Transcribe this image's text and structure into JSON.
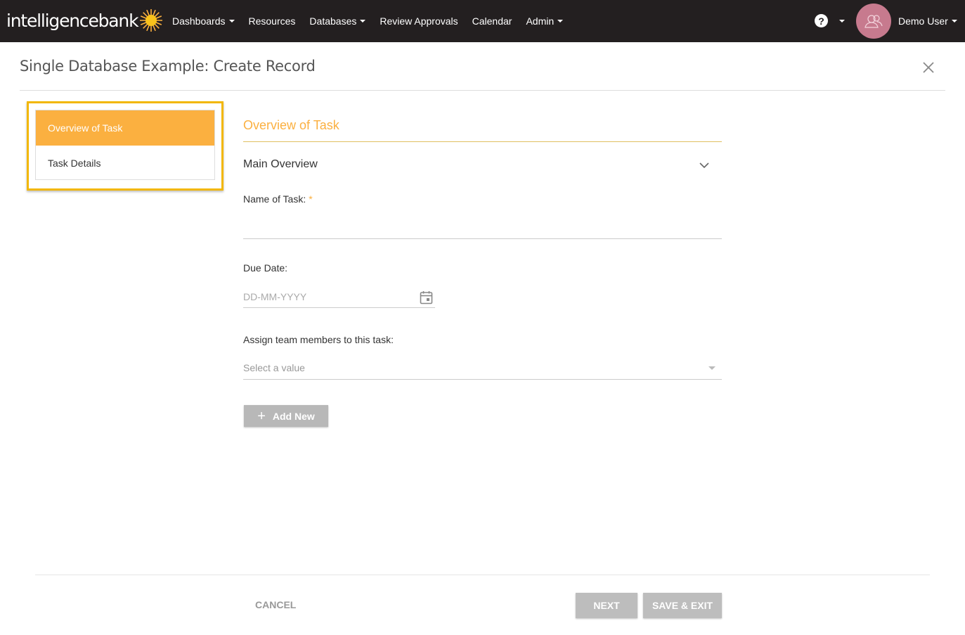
{
  "colors": {
    "topbar": "#231f20",
    "accent": "#fbb040",
    "highlight": "#f2b705",
    "avatar": "#c77a8e",
    "button_disabled": "#bdbdbd"
  },
  "brand": {
    "logo_text": "intelligencebank",
    "logo_icon": "sun-icon"
  },
  "nav": {
    "items": [
      {
        "label": "Dashboards",
        "has_dropdown": true
      },
      {
        "label": "Resources",
        "has_dropdown": false
      },
      {
        "label": "Databases",
        "has_dropdown": true
      },
      {
        "label": "Review Approvals",
        "has_dropdown": false
      },
      {
        "label": "Calendar",
        "has_dropdown": false
      },
      {
        "label": "Admin",
        "has_dropdown": true
      }
    ],
    "help_label": "?",
    "user_name": "Demo User"
  },
  "header": {
    "title": "Single Database Example: Create Record",
    "close_icon": "close-icon"
  },
  "sidebar": {
    "items": [
      {
        "label": "Overview of Task",
        "active": true
      },
      {
        "label": "Task Details",
        "active": false
      }
    ]
  },
  "form": {
    "section_title": "Overview of Task",
    "subsection_title": "Main Overview",
    "name_label": "Name of Task:",
    "required_mark": "*",
    "name_value": "",
    "due_label": "Due Date:",
    "due_placeholder": "DD-MM-YYYY",
    "assign_label": "Assign team members to this task:",
    "assign_placeholder": "Select a value",
    "add_new_label": "Add New"
  },
  "footer": {
    "cancel_label": "CANCEL",
    "next_label": "NEXT",
    "save_exit_label": "SAVE & EXIT"
  }
}
